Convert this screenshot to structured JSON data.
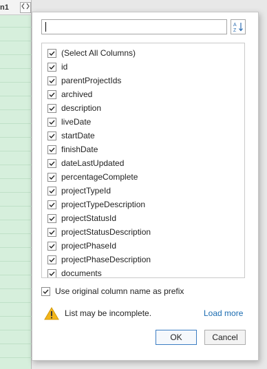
{
  "background": {
    "column_header": "n1"
  },
  "dialog": {
    "search": {
      "value": "",
      "placeholder": ""
    },
    "columns": [
      {
        "label": "(Select All Columns)",
        "checked": true
      },
      {
        "label": "id",
        "checked": true
      },
      {
        "label": "parentProjectIds",
        "checked": true
      },
      {
        "label": "archived",
        "checked": true
      },
      {
        "label": "description",
        "checked": true
      },
      {
        "label": "liveDate",
        "checked": true
      },
      {
        "label": "startDate",
        "checked": true
      },
      {
        "label": "finishDate",
        "checked": true
      },
      {
        "label": "dateLastUpdated",
        "checked": true
      },
      {
        "label": "percentageComplete",
        "checked": true
      },
      {
        "label": "projectTypeId",
        "checked": true
      },
      {
        "label": "projectTypeDescription",
        "checked": true
      },
      {
        "label": "projectStatusId",
        "checked": true
      },
      {
        "label": "projectStatusDescription",
        "checked": true
      },
      {
        "label": "projectPhaseId",
        "checked": true
      },
      {
        "label": "projectPhaseDescription",
        "checked": true
      },
      {
        "label": "documents",
        "checked": true
      }
    ],
    "prefix_option": {
      "label": "Use original column name as prefix",
      "checked": true
    },
    "warning_text": "List may be incomplete.",
    "load_more_label": "Load more",
    "ok_label": "OK",
    "cancel_label": "Cancel"
  },
  "colors": {
    "accent_link": "#1a6bb0",
    "warning_icon": "#f2b51b",
    "grid_fill": "#d6efdc"
  }
}
